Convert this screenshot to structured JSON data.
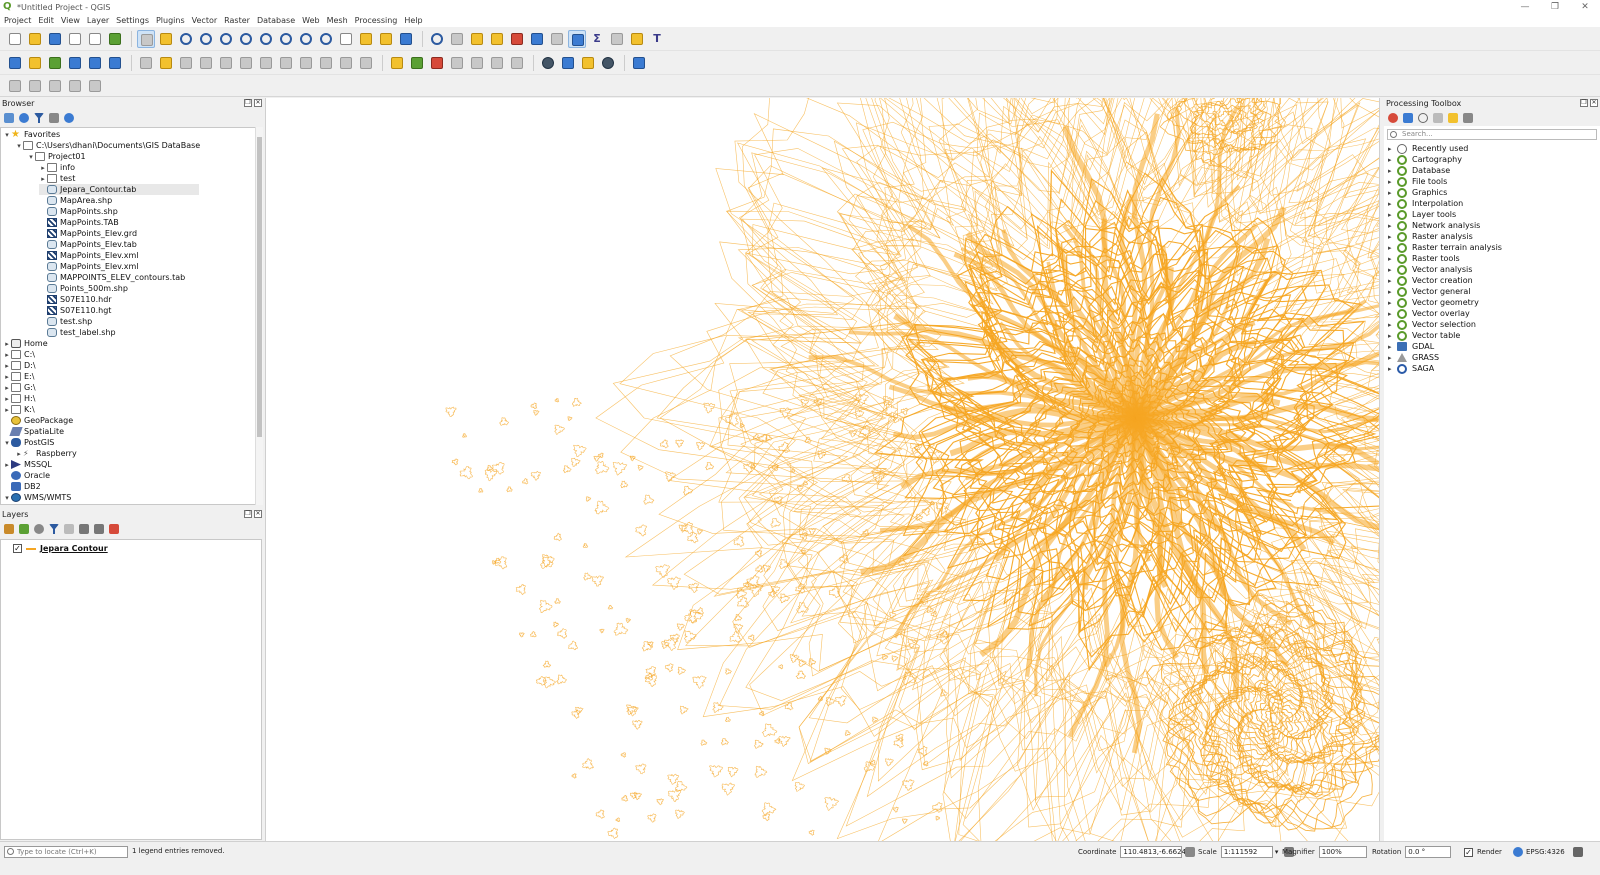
{
  "window": {
    "title": "*Untitled Project - QGIS",
    "controls": [
      "—",
      "❐",
      "✕"
    ]
  },
  "menu": [
    "Project",
    "Edit",
    "View",
    "Layer",
    "Settings",
    "Plugins",
    "Vector",
    "Raster",
    "Database",
    "Web",
    "Mesh",
    "Processing",
    "Help"
  ],
  "browser": {
    "title": "Browser",
    "items": [
      {
        "label": "Favorites",
        "depth": 0,
        "arrow": "▾",
        "icon": "star"
      },
      {
        "label": "C:\\Users\\dhani\\Documents\\GIS DataBase",
        "depth": 1,
        "arrow": "▾",
        "icon": "folder"
      },
      {
        "label": "Project01",
        "depth": 2,
        "arrow": "▾",
        "icon": "folder"
      },
      {
        "label": "info",
        "depth": 3,
        "arrow": "▸",
        "icon": "folder"
      },
      {
        "label": "test",
        "depth": 3,
        "arrow": "▸",
        "icon": "folder"
      },
      {
        "label": "Jepara_Contour.tab",
        "depth": 3,
        "arrow": "",
        "icon": "vec",
        "selected": true
      },
      {
        "label": "MapArea.shp",
        "depth": 3,
        "arrow": "",
        "icon": "vec"
      },
      {
        "label": "MapPoints.shp",
        "depth": 3,
        "arrow": "",
        "icon": "vec"
      },
      {
        "label": "MapPoints.TAB",
        "depth": 3,
        "arrow": "",
        "icon": "ras"
      },
      {
        "label": "MapPoints_Elev.grd",
        "depth": 3,
        "arrow": "",
        "icon": "ras"
      },
      {
        "label": "MapPoints_Elev.tab",
        "depth": 3,
        "arrow": "",
        "icon": "vec"
      },
      {
        "label": "MapPoints_Elev.xml",
        "depth": 3,
        "arrow": "",
        "icon": "ras"
      },
      {
        "label": "MapPoints_Elev.xml",
        "depth": 3,
        "arrow": "",
        "icon": "vec"
      },
      {
        "label": "MAPPOINTS_ELEV_contours.tab",
        "depth": 3,
        "arrow": "",
        "icon": "vec"
      },
      {
        "label": "Points_500m.shp",
        "depth": 3,
        "arrow": "",
        "icon": "vec"
      },
      {
        "label": "S07E110.hdr",
        "depth": 3,
        "arrow": "",
        "icon": "ras"
      },
      {
        "label": "S07E110.hgt",
        "depth": 3,
        "arrow": "",
        "icon": "ras"
      },
      {
        "label": "test.shp",
        "depth": 3,
        "arrow": "",
        "icon": "vec"
      },
      {
        "label": "test_label.shp",
        "depth": 3,
        "arrow": "",
        "icon": "vec"
      },
      {
        "label": "Home",
        "depth": 0,
        "arrow": "▸",
        "icon": "home"
      },
      {
        "label": "C:\\",
        "depth": 0,
        "arrow": "▸",
        "icon": "folder"
      },
      {
        "label": "D:\\",
        "depth": 0,
        "arrow": "▸",
        "icon": "folder"
      },
      {
        "label": "E:\\",
        "depth": 0,
        "arrow": "▸",
        "icon": "folder"
      },
      {
        "label": "G:\\",
        "depth": 0,
        "arrow": "▸",
        "icon": "folder"
      },
      {
        "label": "H:\\",
        "depth": 0,
        "arrow": "▸",
        "icon": "folder"
      },
      {
        "label": "K:\\",
        "depth": 0,
        "arrow": "▸",
        "icon": "folder"
      },
      {
        "label": "GeoPackage",
        "depth": 0,
        "arrow": "",
        "icon": "gpkg"
      },
      {
        "label": "SpatiaLite",
        "depth": 0,
        "arrow": "",
        "icon": "sl"
      },
      {
        "label": "PostGIS",
        "depth": 0,
        "arrow": "▾",
        "icon": "pg"
      },
      {
        "label": "Raspberry",
        "depth": 1,
        "arrow": "▸",
        "icon": "rasp"
      },
      {
        "label": "MSSQL",
        "depth": 0,
        "arrow": "▸",
        "icon": "ms"
      },
      {
        "label": "Oracle",
        "depth": 0,
        "arrow": "",
        "icon": "ora"
      },
      {
        "label": "DB2",
        "depth": 0,
        "arrow": "",
        "icon": "db2"
      },
      {
        "label": "WMS/WMTS",
        "depth": 0,
        "arrow": "▾",
        "icon": "wms"
      }
    ]
  },
  "layers": {
    "title": "Layers",
    "items": [
      {
        "label": "Jepara Contour",
        "checked": true,
        "color": "#f5a623"
      }
    ]
  },
  "toolbox": {
    "title": "Processing Toolbox",
    "search_placeholder": "Search...",
    "items": [
      {
        "label": "Recently used",
        "icon": "clk"
      },
      {
        "label": "Cartography",
        "icon": "qi"
      },
      {
        "label": "Database",
        "icon": "qi"
      },
      {
        "label": "File tools",
        "icon": "qi"
      },
      {
        "label": "Graphics",
        "icon": "qi"
      },
      {
        "label": "Interpolation",
        "icon": "qi"
      },
      {
        "label": "Layer tools",
        "icon": "qi"
      },
      {
        "label": "Network analysis",
        "icon": "qi"
      },
      {
        "label": "Raster analysis",
        "icon": "qi"
      },
      {
        "label": "Raster terrain analysis",
        "icon": "qi"
      },
      {
        "label": "Raster tools",
        "icon": "qi"
      },
      {
        "label": "Vector analysis",
        "icon": "qi"
      },
      {
        "label": "Vector creation",
        "icon": "qi"
      },
      {
        "label": "Vector general",
        "icon": "qi"
      },
      {
        "label": "Vector geometry",
        "icon": "qi"
      },
      {
        "label": "Vector overlay",
        "icon": "qi"
      },
      {
        "label": "Vector selection",
        "icon": "qi"
      },
      {
        "label": "Vector table",
        "icon": "qi"
      },
      {
        "label": "GDAL",
        "icon": "gdal"
      },
      {
        "label": "GRASS",
        "icon": "grass"
      },
      {
        "label": "SAGA",
        "icon": "saga"
      }
    ]
  },
  "status": {
    "locator_placeholder": "Type to locate (Ctrl+K)",
    "message": "1 legend entries removed.",
    "coordinate_label": "Coordinate",
    "coordinate_value": "110.4813,-6.6624",
    "scale_label": "Scale",
    "scale_value": "1:111592",
    "magnifier_label": "Magnifier",
    "magnifier_value": "100%",
    "rotation_label": "Rotation",
    "rotation_value": "0.0 °",
    "render_label": "Render",
    "crs": "EPSG:4326"
  },
  "colors": {
    "contour": "#f5a623",
    "accent": "#5a9a2a"
  }
}
